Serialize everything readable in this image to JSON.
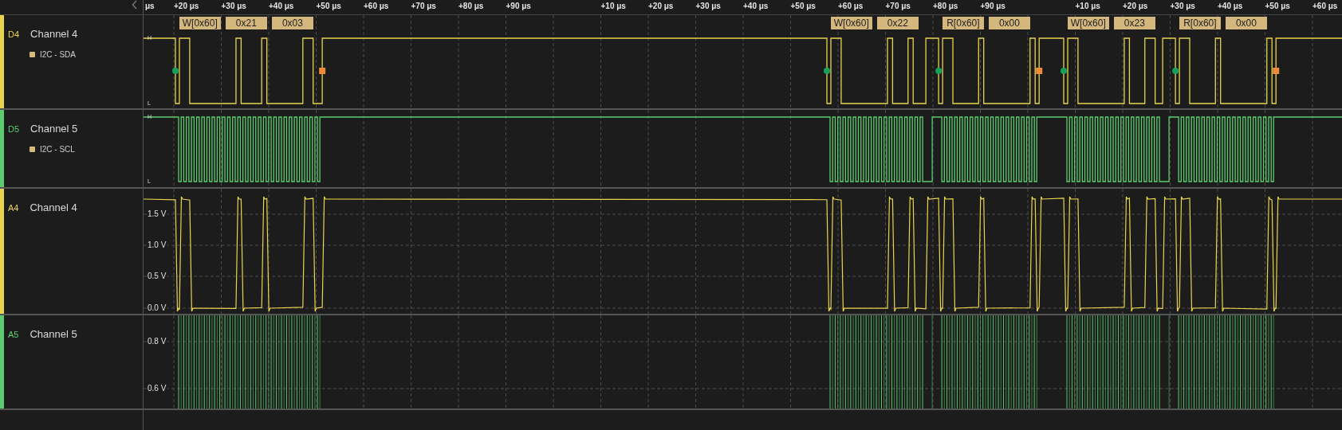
{
  "ruler": {
    "segments": [
      [
        "μs",
        "+20 μs",
        "+30 μs",
        "+40 μs",
        "+50 μs",
        "+60 μs",
        "+70 μs",
        "+80 μs",
        "+90 μs"
      ],
      [
        "+10 μs",
        "+20 μs",
        "+30 μs",
        "+40 μs",
        "+50 μs",
        "+60 μs",
        "+70 μs",
        "+80 μs",
        "+90 μs"
      ],
      [
        "+10 μs",
        "+20 μs",
        "+30 μs",
        "+40 μs",
        "+50 μs",
        "+60 μs"
      ]
    ]
  },
  "channels": [
    {
      "kind": "digital",
      "tag": "D4",
      "name": "Channel 4",
      "color": "#e8d44d",
      "analyzer": "I2C - SDA",
      "high_label": "H",
      "low_label": "L",
      "decoded": [
        {
          "packets": [
            "W[0x60]",
            "0x21",
            "0x03"
          ]
        },
        {
          "packets": [
            "W[0x60]",
            "0x22",
            "R[0x60]",
            "0x00"
          ]
        },
        {
          "packets": [
            "W[0x60]",
            "0x23",
            "R[0x60]",
            "0x00"
          ]
        }
      ]
    },
    {
      "kind": "digital",
      "tag": "D5",
      "name": "Channel 5",
      "color": "#5ccd6f",
      "analyzer": "I2C - SCL",
      "high_label": "H",
      "low_label": "L"
    },
    {
      "kind": "analog",
      "tag": "A4",
      "name": "Channel 4",
      "color": "#e8d44d",
      "y_labels": [
        "1.5 V",
        "1.0 V",
        "0.5 V",
        "0.0 V"
      ]
    },
    {
      "kind": "analog",
      "tag": "A5",
      "name": "Channel 5",
      "color": "#5ccd6f",
      "y_labels": [
        "0.8 V",
        "0.6 V"
      ]
    }
  ]
}
